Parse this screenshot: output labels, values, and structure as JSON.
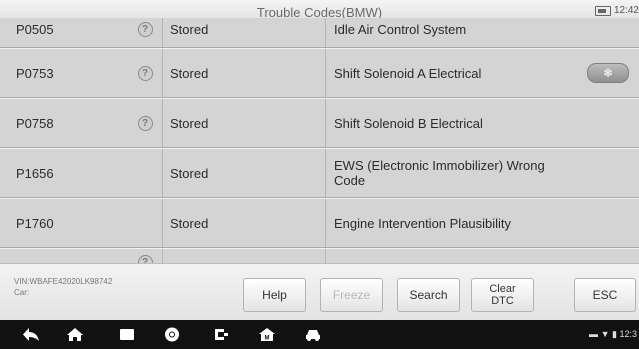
{
  "header": {
    "title": "Trouble Codes(BMW)",
    "time": "12:42",
    "battery_icon": "battery-icon"
  },
  "rows": [
    {
      "code": "P0505",
      "help": true,
      "status": "Stored",
      "description": "Idle Air Control System"
    },
    {
      "code": "P0753",
      "help": true,
      "status": "Stored",
      "description": "Shift Solenoid A Electrical",
      "freeze_frame_icon": "snowflake-icon"
    },
    {
      "code": "P0758",
      "help": true,
      "status": "Stored",
      "description": "Shift Solenoid B Electrical"
    },
    {
      "code": "P1656",
      "help": false,
      "status": "Stored",
      "description": "EWS (Electronic Immobilizer) Wrong Code"
    },
    {
      "code": "P1760",
      "help": false,
      "status": "Stored",
      "description": "Engine Intervention Plausibility"
    },
    {
      "code": "",
      "help": true,
      "status": "",
      "description": ""
    }
  ],
  "vehicle": {
    "vin": "VIN:WBAFE42020LK98742",
    "car": "Car:"
  },
  "toolbar": {
    "help": "Help",
    "freeze": "Freeze",
    "search": "Search",
    "clear_line1": "Clear",
    "clear_line2": "DTC",
    "esc": "ESC"
  },
  "navbar": {
    "icons": [
      "back-icon",
      "home-icon",
      "recent-apps-icon",
      "chrome-icon",
      "vci-icon",
      "autel-home-icon",
      "car-icon"
    ],
    "status_time": "12:3"
  },
  "colors": {
    "row_bg": "#d4d4d4",
    "bottom_bar": "#ececec",
    "nav_bg": "#111111"
  }
}
